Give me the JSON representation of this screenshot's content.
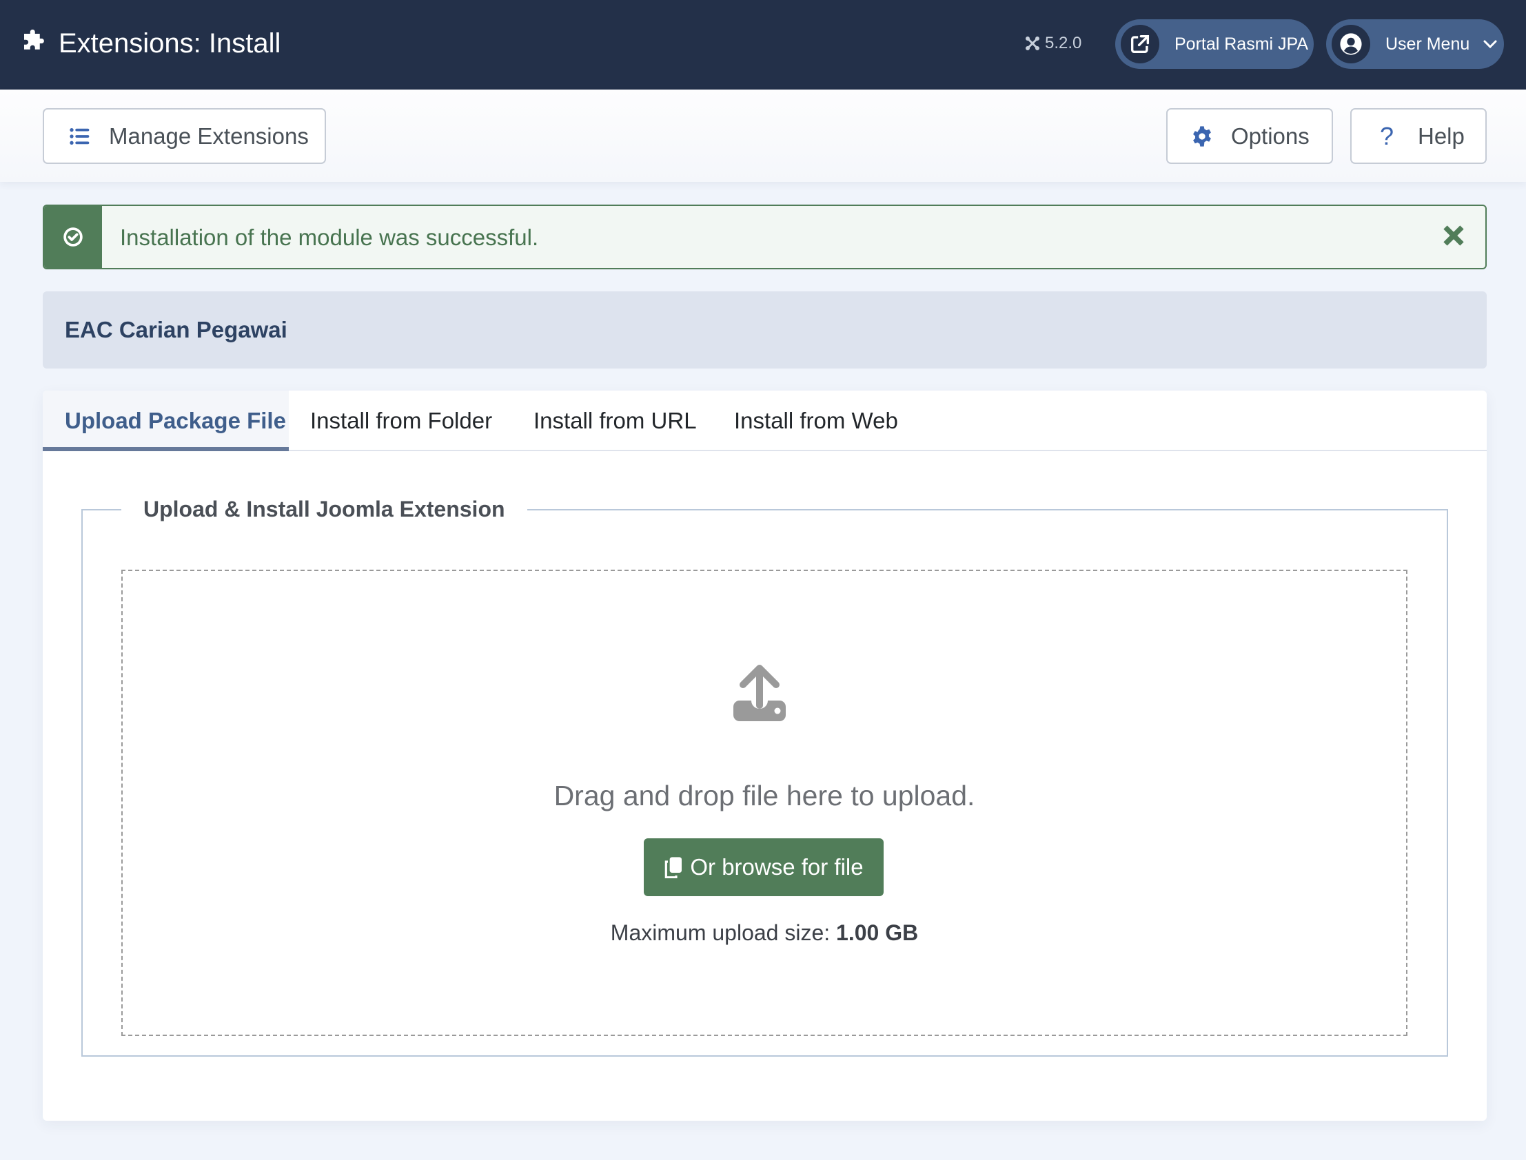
{
  "header": {
    "title": "Extensions: Install",
    "logo_icon": "puzzle-piece-icon",
    "version": "5.2.0",
    "version_icon": "joomla-logo-icon",
    "portal_link": {
      "label": "Portal Rasmi JPA",
      "icon": "external-link-icon"
    },
    "user_menu": {
      "label": "User Menu",
      "icon": "user-circle-icon",
      "chevron": "chevron-down-icon"
    }
  },
  "toolbar": {
    "manage_extensions": {
      "label": "Manage Extensions",
      "icon": "list-icon"
    },
    "options": {
      "label": "Options",
      "icon": "gear-icon"
    },
    "help": {
      "label": "Help",
      "icon": "question-icon",
      "glyph": "?"
    }
  },
  "alert": {
    "type": "success",
    "message": "Installation of the module was successful.",
    "icon": "check-circle-icon",
    "close_icon": "close-icon"
  },
  "module_title": "EAC Carian Pegawai",
  "tabs": [
    {
      "label": "Upload Package File",
      "active": true
    },
    {
      "label": "Install from Folder",
      "active": false
    },
    {
      "label": "Install from URL",
      "active": false
    },
    {
      "label": "Install from Web",
      "active": false
    }
  ],
  "upload": {
    "legend": "Upload & Install Joomla Extension",
    "drag_text": "Drag and drop file here to upload.",
    "browse_label": "Or browse for file",
    "max_size_label": "Maximum upload size:",
    "max_size_value": "1.00 GB"
  },
  "colors": {
    "header_bg": "#233049",
    "pill_bg": "#45618b",
    "success": "#517d59",
    "accent_blue": "#3b65b0",
    "tab_active": "#3f5e8b",
    "page_bg": "#f0f4fb"
  }
}
